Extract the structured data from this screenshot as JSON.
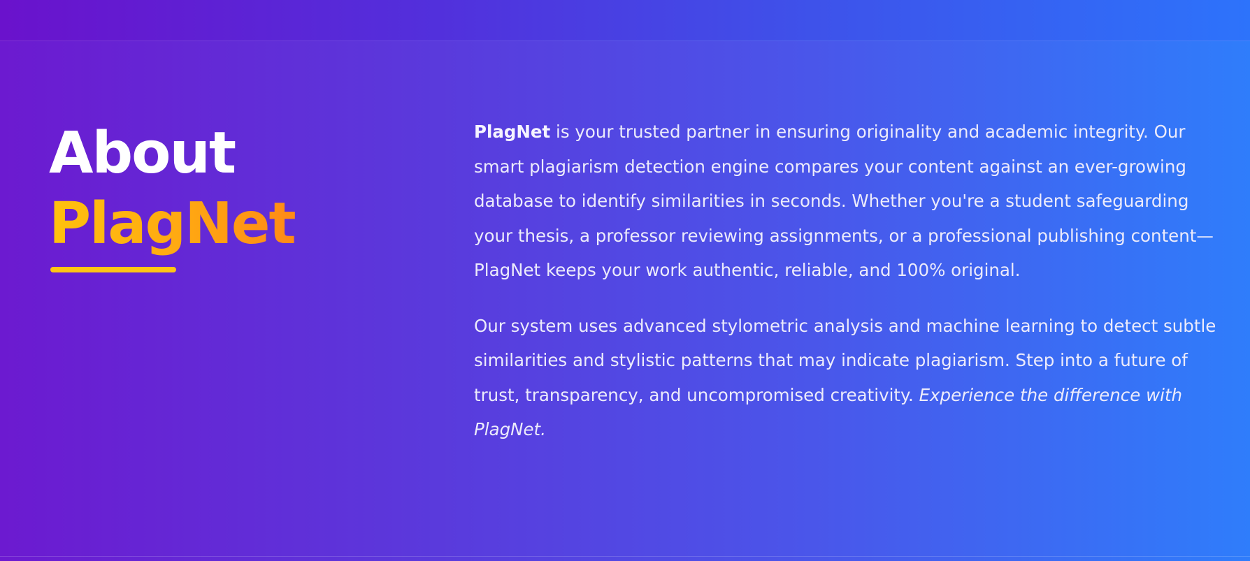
{
  "about": {
    "heading_line1": "About",
    "heading_line2": "PlagNet",
    "paragraph1": {
      "brand": "PlagNet",
      "body": " is your trusted partner in ensuring originality and academic integrity. Our smart plagiarism detection engine compares your content against an ever-growing database to identify similarities in seconds. Whether you're a student safeguarding your thesis, a professor reviewing assignments, or a professional publishing content—PlagNet keeps your work authentic, reliable, and 100% original."
    },
    "paragraph2": {
      "body": "Our system uses advanced stylometric analysis and machine learning to detect subtle similarities and stylistic patterns that may indicate plagiarism. Step into a future of trust, transparency, and uncompromised creativity. ",
      "closing": "Experience the difference with PlagNet."
    }
  },
  "colors": {
    "gradient_start": "#6c1ad0",
    "gradient_end": "#2f7dfb",
    "accent_orange": "#ffa812",
    "underline_yellow": "#ffc514",
    "text_light": "#ecebfb",
    "heading_white": "#ffffff"
  }
}
